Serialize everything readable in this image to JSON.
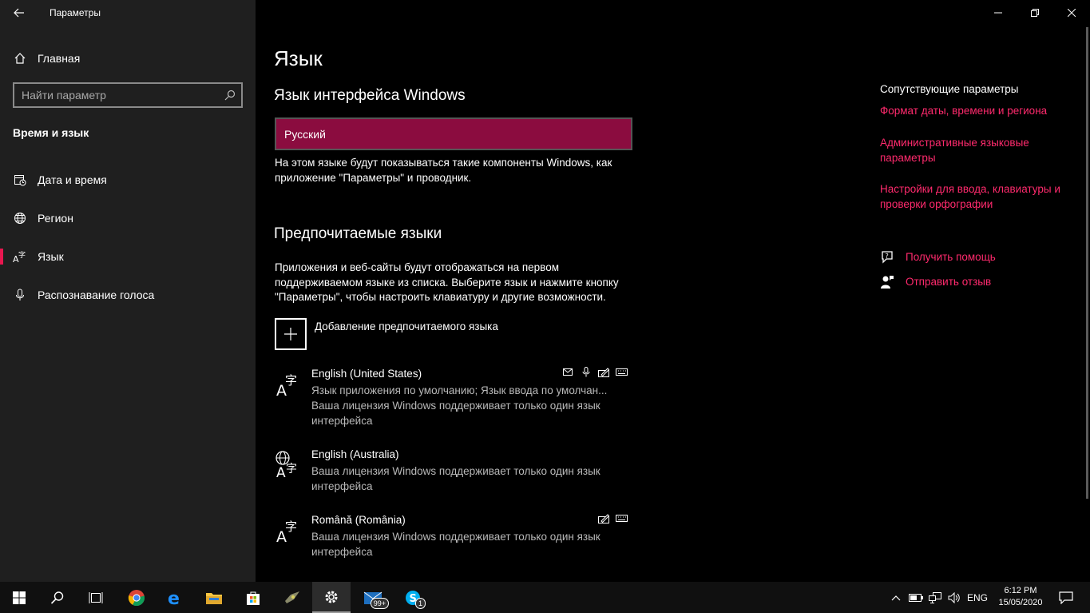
{
  "window": {
    "app_title": "Параметры",
    "controls": {
      "minimize": "–",
      "maximize": "❐",
      "close": "✕"
    }
  },
  "sidebar": {
    "home_label": "Главная",
    "search": {
      "placeholder": "Найти параметр",
      "value": ""
    },
    "section_heading": "Время и язык",
    "items": [
      {
        "label": "Дата и время",
        "icon": "calendar-clock-icon"
      },
      {
        "label": "Регион",
        "icon": "globe-icon"
      },
      {
        "label": "Язык",
        "icon": "language-icon",
        "active": true
      },
      {
        "label": "Распознавание голоса",
        "icon": "microphone-icon"
      }
    ]
  },
  "main": {
    "title": "Язык",
    "display_language": {
      "heading": "Язык интерфейса Windows",
      "selected": "Русский",
      "description": "На этом языке будут показываться такие компоненты Windows, как приложение \"Параметры\" и проводник."
    },
    "preferred": {
      "heading": "Предпочитаемые языки",
      "description": "Приложения и веб-сайты будут отображаться на первом поддерживаемом языке из списка. Выберите язык и нажмите кнопку \"Параметры\", чтобы настроить клавиатуру и другие возможности.",
      "add_label": "Добавление предпочитаемого языка",
      "languages": [
        {
          "name": "English (United States)",
          "line1": "Язык приложения по умолчанию; Язык ввода по умолчан...",
          "line2": "Ваша лицензия Windows поддерживает только один язык интерфейса"
        },
        {
          "name": "English (Australia)",
          "line1": "Ваша лицензия Windows поддерживает только один язык интерфейса"
        },
        {
          "name": "Română (România)",
          "line1": "Ваша лицензия Windows поддерживает только один язык интерфейса"
        }
      ]
    }
  },
  "related": {
    "title": "Сопутствующие параметры",
    "links": [
      "Формат даты, времени и региона",
      "Административные языковые параметры",
      "Настройки для ввода, клавиатуры и проверки орфографии"
    ],
    "help": "Получить помощь",
    "feedback": "Отправить отзыв"
  },
  "taskbar": {
    "mail_badge": "99+",
    "skype_badge": "1",
    "input_language": "ENG",
    "time": "6:12 PM",
    "date": "15/05/2020"
  },
  "colors": {
    "accent": "#e8174f",
    "link": "#ff2a6d",
    "selected_bg": "#8b0c3f",
    "sidebar_bg": "#1f1f1f"
  }
}
